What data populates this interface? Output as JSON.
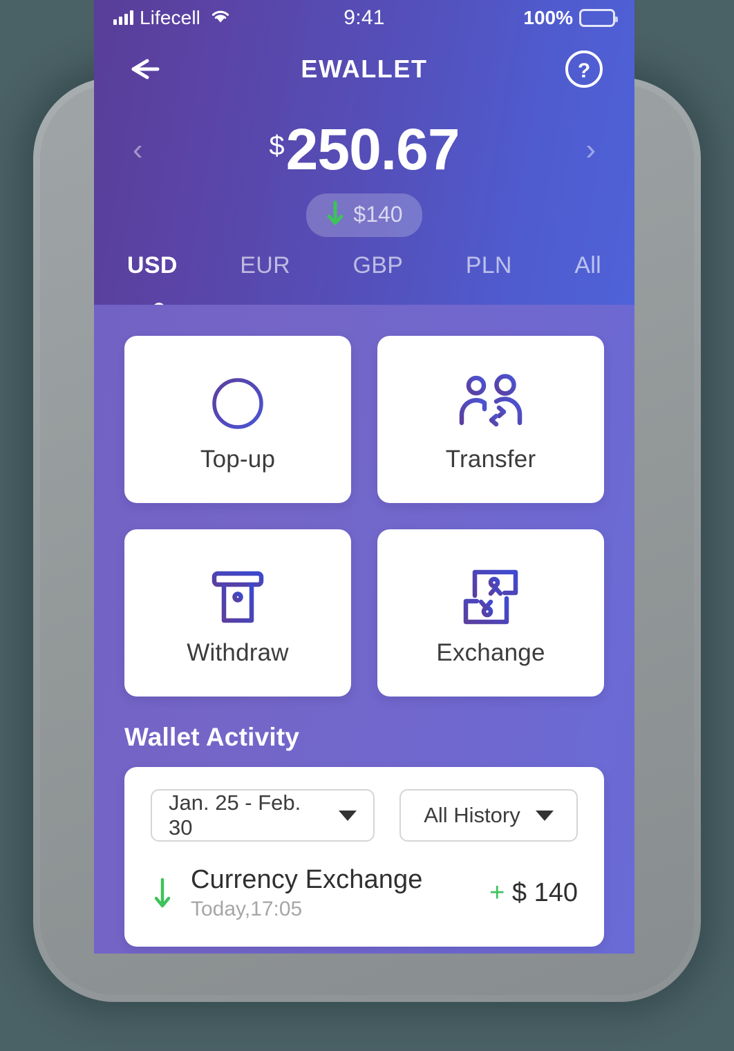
{
  "status_bar": {
    "carrier": "Lifecell",
    "time": "9:41",
    "battery_percent": "100%"
  },
  "header": {
    "title": "EWALLET",
    "back_icon": "arrow-left-icon",
    "help_icon": "help-circle-icon"
  },
  "balance": {
    "currency_symbol": "$",
    "amount": "250.67",
    "prev_icon": "chevron-left-icon",
    "next_icon": "chevron-right-icon",
    "delta_amount": "$140",
    "delta_direction": "down",
    "delta_color": "#3dc25c"
  },
  "currency_tabs": [
    {
      "label": "USD",
      "active": true
    },
    {
      "label": "EUR",
      "active": false
    },
    {
      "label": "GBP",
      "active": false
    },
    {
      "label": "PLN",
      "active": false
    },
    {
      "label": "All",
      "active": false
    }
  ],
  "actions": [
    {
      "label": "Top-up",
      "icon": "plus-circle-icon"
    },
    {
      "label": "Transfer",
      "icon": "people-transfer-icon"
    },
    {
      "label": "Withdraw",
      "icon": "atm-slot-icon"
    },
    {
      "label": "Exchange",
      "icon": "currency-exchange-icon"
    }
  ],
  "activity": {
    "section_title": "Wallet Activity",
    "filters": [
      {
        "label": "Jan. 25 - Feb. 30",
        "icon": "caret-down-icon"
      },
      {
        "label": "All History",
        "icon": "caret-down-icon"
      }
    ],
    "transactions": [
      {
        "title": "Currency Exchange",
        "time": "Today,17:05",
        "sign": "+",
        "amount": "$ 140",
        "direction_icon": "arrow-down-icon"
      }
    ]
  },
  "colors": {
    "accent_purple": "#5a4fc0",
    "header_gradient_start": "#593e99",
    "header_gradient_end": "#4f62d8",
    "body_purple": "#7467c8",
    "positive_green": "#3dc25c",
    "page_background": "#4a6166"
  }
}
